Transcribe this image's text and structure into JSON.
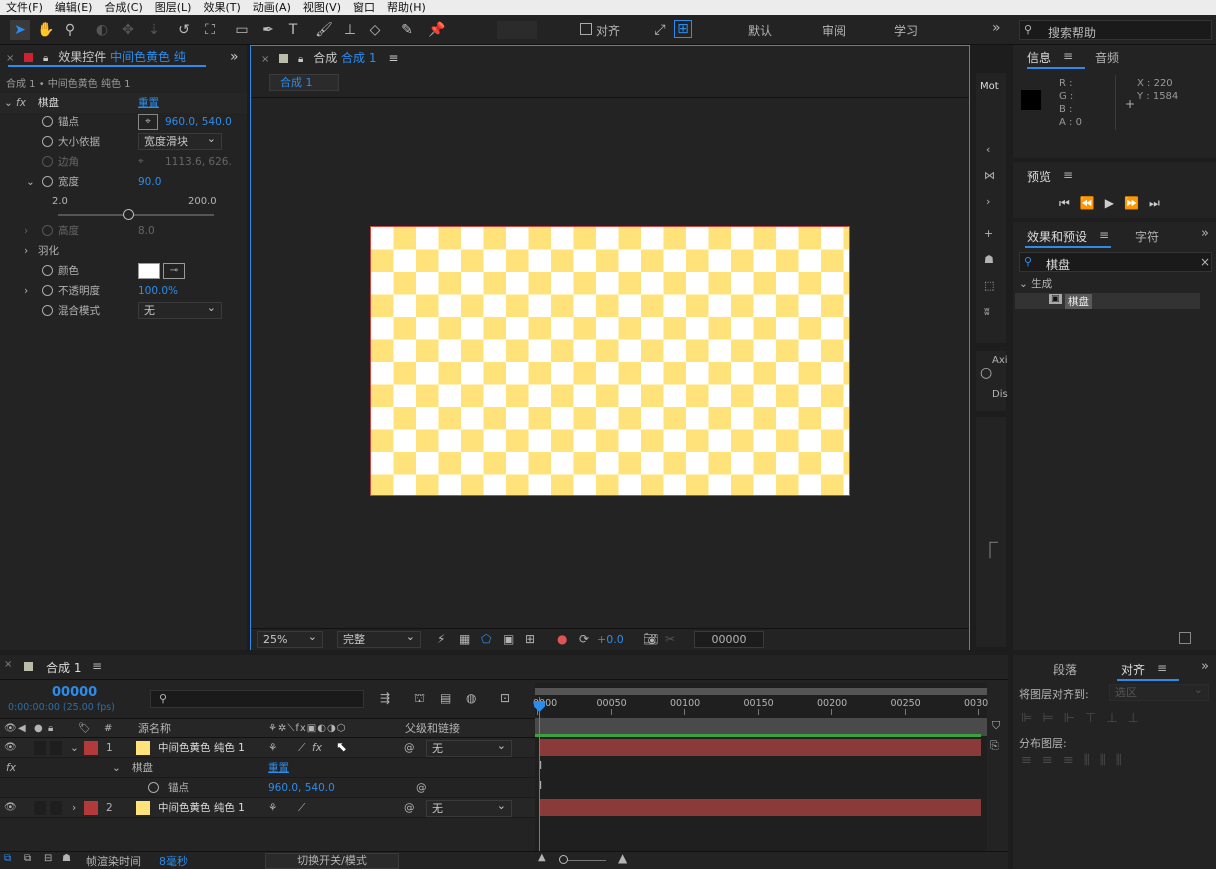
{
  "menu": [
    "文件(F)",
    "编辑(E)",
    "合成(C)",
    "图层(L)",
    "效果(T)",
    "动画(A)",
    "视图(V)",
    "窗口",
    "帮助(H)"
  ],
  "toolbar": {
    "snap_label": "对齐",
    "workspaces": [
      "默认",
      "审阅",
      "学习"
    ],
    "search_placeholder": "搜索帮助"
  },
  "effects_panel": {
    "tab_prefix": "效果控件",
    "tab_layer": "中间色黄色 纯",
    "breadcrumb": "合成 1 • 中间色黄色 纯色 1",
    "effect_name": "棋盘",
    "reset": "重置",
    "props": {
      "anchor_label": "锚点",
      "anchor_value": "960.0, 540.0",
      "size_label": "大小依据",
      "size_value": "宽度滑块",
      "corner_label": "边角",
      "corner_value": "1113.6, 626.",
      "width_label": "宽度",
      "width_value": "90.0",
      "slider_min": "2.0",
      "slider_max": "200.0",
      "slider_fraction": 0.45,
      "height_label": "高度",
      "height_value": "8.0",
      "feather_label": "羽化",
      "color_label": "颜色",
      "opacity_label": "不透明度",
      "opacity_value": "100.0%",
      "blend_label": "混合模式",
      "blend_value": "无"
    }
  },
  "comp_panel": {
    "tab_prefix": "合成",
    "tab_name": "合成 1",
    "crumb": "合成 1",
    "zoom": "25%",
    "quality": "完整",
    "exposure": "+0.0",
    "timecode": "00000"
  },
  "mid_strip": {
    "mot": "Mot",
    "axi": "Axi",
    "dis": "Dis"
  },
  "info_panel": {
    "tab_info": "信息",
    "tab_audio": "音频",
    "r": "R :",
    "g": "G :",
    "b": "B :",
    "a": "A : 0",
    "x": "X : 220",
    "y": "Y : 1584"
  },
  "preview_panel": {
    "title": "预览"
  },
  "effects_presets": {
    "tab": "效果和预设",
    "tab_char": "字符",
    "search_value": "棋盘",
    "category": "生成",
    "item": "棋盘"
  },
  "align_panel": {
    "tab_paragraph": "段落",
    "tab_align": "对齐",
    "align_to_label": "将图层对齐到:",
    "align_to_value": "选区",
    "distribute_label": "分布图层:"
  },
  "timeline": {
    "tab": "合成 1",
    "timecode": "00000",
    "timecode_sub": "0:00:00:00 (25.00 fps)",
    "col_source": "源名称",
    "col_parent": "父级和链接",
    "ticks": [
      "0000",
      "00050",
      "00100",
      "00150",
      "00200",
      "00250",
      "0030"
    ],
    "layers": [
      {
        "num": "1",
        "name": "中间色黄色 纯色 1",
        "parent": "无"
      },
      {
        "num": "2",
        "name": "中间色黄色 纯色 1",
        "parent": "无"
      }
    ],
    "fx_label": "fx",
    "sub_effect": "棋盘",
    "sub_reset": "重置",
    "sub_anchor": "锚点",
    "sub_anchor_value": "960.0, 540.0",
    "render_label": "帧渲染时间",
    "render_value": "8毫秒",
    "toggle_label": "切换开关/模式"
  },
  "colors": {
    "accent": "#2d8ceb",
    "layer_bar": "#8b3a3a",
    "label_red": "#b33a3a",
    "solid_yellow": "#ffe37a"
  }
}
